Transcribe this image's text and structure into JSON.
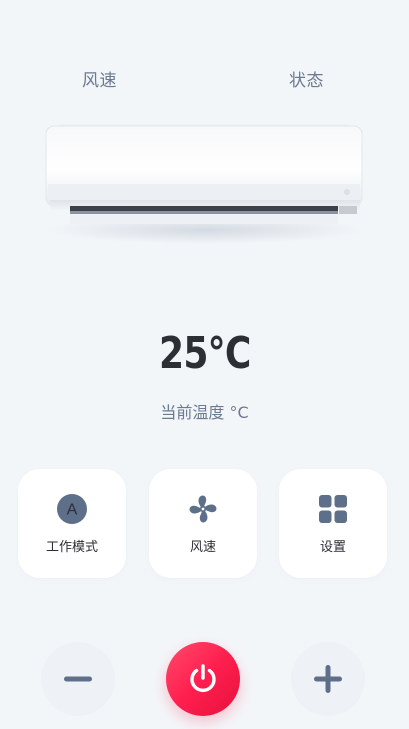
{
  "header": {
    "left_label": "风速",
    "right_label": "状态"
  },
  "device": {
    "image": "wall-mounted-air-conditioner"
  },
  "temperature": {
    "value": "25°C",
    "caption": "当前温度 °C"
  },
  "cards": [
    {
      "label": "工作模式",
      "icon": "mode-a-icon",
      "badge": "A"
    },
    {
      "label": "风速",
      "icon": "fan-icon"
    },
    {
      "label": "设置",
      "icon": "grid-icon"
    }
  ],
  "controls": {
    "minus_icon": "minus-icon",
    "power_icon": "power-icon",
    "plus_icon": "plus-icon"
  },
  "colors": {
    "background": "#f3f6f9",
    "icon": "#5e6f8a",
    "power_gradient_start": "#ff4a6a",
    "power_gradient_end": "#e6103c",
    "text_primary": "#2c2f33",
    "text_secondary": "#6b7a90"
  }
}
